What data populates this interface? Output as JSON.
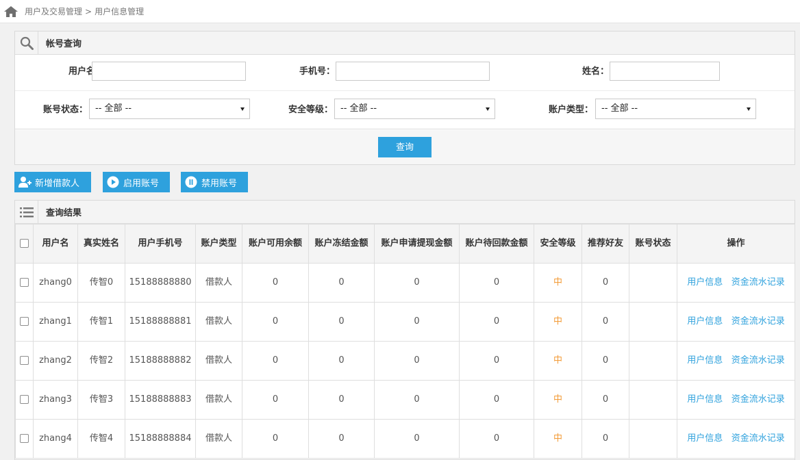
{
  "breadcrumb": {
    "section": "用户及交易管理",
    "separator": ">",
    "page": "用户信息管理"
  },
  "search": {
    "title": "帐号查询",
    "fields": {
      "username_label": "用户名：",
      "phone_label": "手机号：",
      "name_label": "姓名：",
      "account_status_label": "账号状态：",
      "account_status_value": "-- 全部 --",
      "security_level_label": "安全等级：",
      "security_level_value": "-- 全部 --",
      "account_type_label": "账户类型：",
      "account_type_value": "-- 全部 --"
    },
    "query_button": "查询"
  },
  "actions": {
    "add_borrower": "新增借款人",
    "enable_account": "启用账号",
    "disable_account": "禁用账号"
  },
  "results": {
    "title": "查询结果",
    "headers": [
      "用户名",
      "真实姓名",
      "用户手机号",
      "账户类型",
      "账户可用余额",
      "账户冻结金额",
      "账户申请提现金额",
      "账户待回款金额",
      "安全等级",
      "推荐好友",
      "账号状态",
      "操作"
    ],
    "rows": [
      {
        "username": "zhang0",
        "real_name": "传智0",
        "phone": "15188888880",
        "account_type": "借款人",
        "available": "0",
        "frozen": "0",
        "withdraw": "0",
        "pending": "0",
        "security": "中",
        "referrals": "0",
        "status": "",
        "op_info": "用户信息",
        "op_flow": "资金流水记录"
      },
      {
        "username": "zhang1",
        "real_name": "传智1",
        "phone": "15188888881",
        "account_type": "借款人",
        "available": "0",
        "frozen": "0",
        "withdraw": "0",
        "pending": "0",
        "security": "中",
        "referrals": "0",
        "status": "",
        "op_info": "用户信息",
        "op_flow": "资金流水记录"
      },
      {
        "username": "zhang2",
        "real_name": "传智2",
        "phone": "15188888882",
        "account_type": "借款人",
        "available": "0",
        "frozen": "0",
        "withdraw": "0",
        "pending": "0",
        "security": "中",
        "referrals": "0",
        "status": "",
        "op_info": "用户信息",
        "op_flow": "资金流水记录"
      },
      {
        "username": "zhang3",
        "real_name": "传智3",
        "phone": "15188888883",
        "account_type": "借款人",
        "available": "0",
        "frozen": "0",
        "withdraw": "0",
        "pending": "0",
        "security": "中",
        "referrals": "0",
        "status": "",
        "op_info": "用户信息",
        "op_flow": "资金流水记录"
      },
      {
        "username": "zhang4",
        "real_name": "传智4",
        "phone": "15188888884",
        "account_type": "借款人",
        "available": "0",
        "frozen": "0",
        "withdraw": "0",
        "pending": "0",
        "security": "中",
        "referrals": "0",
        "status": "",
        "op_info": "用户信息",
        "op_flow": "资金流水记录"
      }
    ]
  },
  "colors": {
    "accent": "#2ea1dd",
    "warning": "#f39b37",
    "header_bg": "#f4f4f4"
  },
  "icons": {
    "home": "home-icon",
    "search": "magnifier-icon",
    "list": "list-icon",
    "add_user": "add-user-icon",
    "play": "play-icon",
    "pause": "pause-icon"
  }
}
